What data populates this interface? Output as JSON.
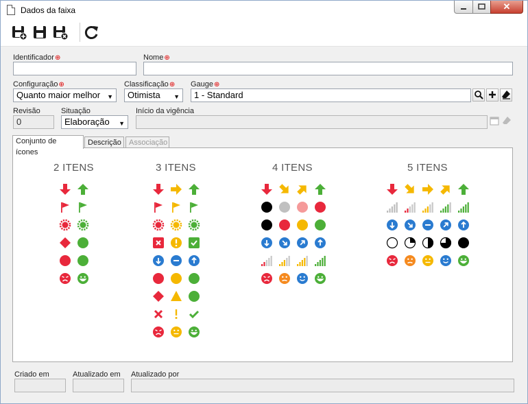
{
  "window": {
    "title": "Dados da faixa"
  },
  "form": {
    "identificador_label": "Identificador",
    "nome_label": "Nome",
    "identificador_value": "",
    "nome_value": "",
    "configuracao_label": "Configuração",
    "configuracao_value": "Quanto maior melhor",
    "classificacao_label": "Classificação",
    "classificacao_value": "Otimista",
    "gauge_label": "Gauge",
    "gauge_value": "1 - Standard",
    "revisao_label": "Revisão",
    "revisao_value": "0",
    "situacao_label": "Situação",
    "situacao_value": "Elaboração",
    "inicio_label": "Início da vigência",
    "inicio_value": ""
  },
  "tabs": [
    {
      "label": "Conjunto de ícones",
      "state": "active"
    },
    {
      "label": "Descrição",
      "state": "normal"
    },
    {
      "label": "Associação",
      "state": "disabled"
    }
  ],
  "icon_sets": {
    "col2": {
      "title": "2 ITENS",
      "rows": [
        [
          "arrow-down-red",
          "arrow-up-green"
        ],
        [
          "flag-red",
          "flag-green"
        ],
        [
          "badge-red",
          "badge-green"
        ],
        [
          "diamond-red",
          "circle-green"
        ],
        [
          "circle-red",
          "circle-green"
        ],
        [
          "face-sad-red",
          "face-happy-green"
        ]
      ]
    },
    "col3": {
      "title": "3 ITENS",
      "rows": [
        [
          "arrow-down-red",
          "arrow-right-yellow",
          "arrow-up-green"
        ],
        [
          "flag-red",
          "flag-yellow",
          "flag-green"
        ],
        [
          "badge-red",
          "badge-yellow",
          "badge-green"
        ],
        [
          "x-box-red",
          "exclaim-circle-yellow",
          "check-box-green"
        ],
        [
          "circle-arrow-down-blue",
          "circle-minus-blue",
          "circle-arrow-up-blue"
        ],
        [
          "circle-red",
          "circle-yellow",
          "circle-green"
        ],
        [
          "diamond-red",
          "triangle-yellow",
          "circle-green"
        ],
        [
          "x-red",
          "exclaim-yellow",
          "check-green"
        ],
        [
          "face-sad-red",
          "face-neutral-yellow",
          "face-happy-green"
        ]
      ]
    },
    "col4": {
      "title": "4 ITENS",
      "rows": [
        [
          "arrow-down-red",
          "arrow-downright-yellow",
          "arrow-upright-yellow",
          "arrow-up-green"
        ],
        [
          "circle-black",
          "circle-gray",
          "circle-pink",
          "circle-red"
        ],
        [
          "circle-black",
          "circle-red",
          "circle-yellow",
          "circle-green"
        ],
        [
          "circle-arrow-down-blue",
          "circle-arrow-downright-blue",
          "circle-arrow-upright-blue",
          "circle-arrow-up-blue"
        ],
        [
          "signal-1-red",
          "signal-2-yellow",
          "signal-3-yellow",
          "signal-4-green"
        ],
        [
          "face-sad-red",
          "face-frown-orange",
          "face-smile-blue",
          "face-happy-green"
        ]
      ]
    },
    "col5": {
      "title": "5 ITENS",
      "rows": [
        [
          "arrow-down-red",
          "arrow-downright-yellow",
          "arrow-right-yellow",
          "arrow-upright-yellow",
          "arrow-up-green"
        ],
        [
          "signal-0-gray",
          "signal-1-red",
          "signal-2-yellow",
          "signal-3-green",
          "signal-4-green"
        ],
        [
          "circle-arrow-down-blue",
          "circle-arrow-downright-blue",
          "circle-minus-blue",
          "circle-arrow-upright-blue",
          "circle-arrow-up-blue"
        ],
        [
          "pie-0",
          "pie-1",
          "pie-2",
          "pie-3",
          "pie-4"
        ],
        [
          "face-sad-red",
          "face-frown-orange",
          "face-neutral-yellow",
          "face-smile-blue",
          "face-happy-green"
        ]
      ]
    }
  },
  "footer": {
    "criado_label": "Criado em",
    "criado_value": "",
    "atualizado_label": "Atualizado em",
    "atualizado_value": "",
    "atualizado_por_label": "Atualizado por",
    "atualizado_por_value": ""
  },
  "colors": {
    "red": "#e8283c",
    "yellow": "#f5b800",
    "green": "#4caf38",
    "blue": "#2a7bd0",
    "orange": "#f58a1f",
    "gray": "#c0c0c0",
    "pink": "#f59a9a"
  }
}
